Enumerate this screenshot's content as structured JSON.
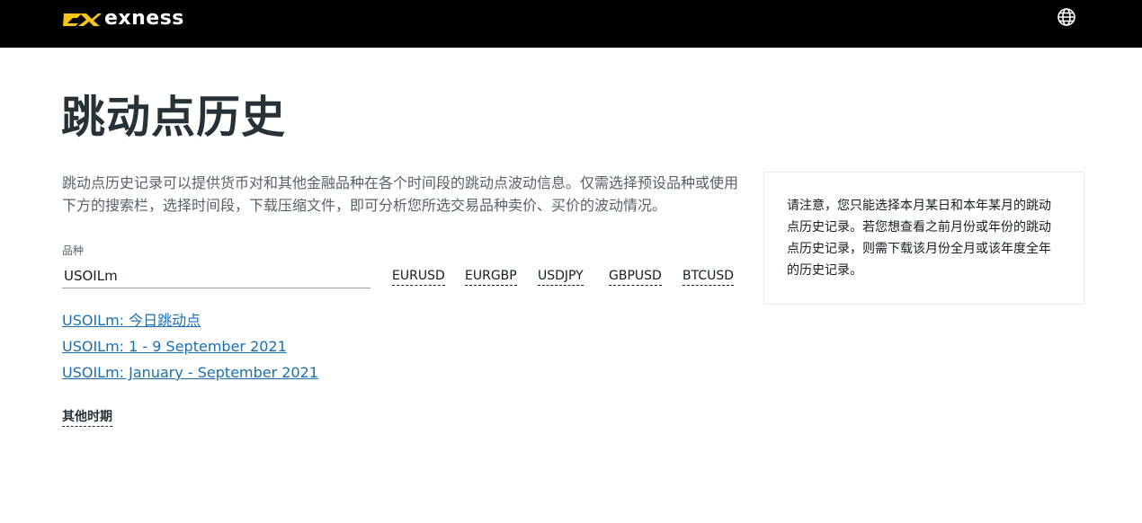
{
  "header": {
    "logo_text": "exness",
    "brand_color": "#F5C518",
    "globe_icon": "globe-icon"
  },
  "page": {
    "title": "跳动点历史",
    "description": "跳动点历史记录可以提供货币对和其他金融品种在各个时间段的跳动点波动信息。仅需选择预设品种或使用下方的搜索栏，选择时间段，下载压缩文件，即可分析您所选交易品种卖价、买价的波动情况。"
  },
  "search": {
    "label": "品种",
    "value": "USOILm"
  },
  "quick_symbols": [
    "EURUSD",
    "EURGBP",
    "USDJPY",
    "GBPUSD",
    "BTCUSD"
  ],
  "download_links": [
    "USOILm: 今日跳动点",
    "USOILm: 1 - 9 September 2021",
    "USOILm: January - September 2021"
  ],
  "other_periods": "其他时期",
  "notice": {
    "text": "请注意，您只能选择本月某日和本年某月的跳动点历史记录。若您想查看之前月份或年份的跳动点历史记录，则需下载该月份全月或该年度全年的历史记录。"
  },
  "colors": {
    "link": "#1a6fb0",
    "title": "#263238",
    "topbar": "#000000"
  }
}
